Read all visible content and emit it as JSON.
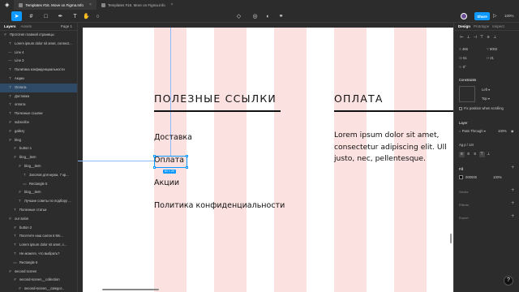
{
  "browser_tabs": [
    {
      "label": "Templates #16. Move on Figma.Info",
      "active": true
    },
    {
      "label": "Templates #16. More on Figma.Info",
      "active": false
    }
  ],
  "toolbar": {
    "present_icon": "play-icon",
    "share_label": "Share",
    "zoom_label": "100%"
  },
  "left_panel": {
    "tab_layers": "Layers",
    "tab_assets": "Assets",
    "page_label": "Page 1",
    "layers": [
      {
        "label": "Прототип главной страницы",
        "icon": "#",
        "indent": 0
      },
      {
        "label": "Lorem ipsum dolor sit amet, consect...",
        "icon": "T",
        "indent": 1
      },
      {
        "label": "Line 4",
        "icon": "—",
        "indent": 1
      },
      {
        "label": "Line 3",
        "icon": "—",
        "indent": 1
      },
      {
        "label": "Политика конфиденциальности",
        "icon": "T",
        "indent": 1
      },
      {
        "label": "Акции",
        "icon": "T",
        "indent": 1
      },
      {
        "label": "Оплата",
        "icon": "T",
        "indent": 1,
        "selected": true
      },
      {
        "label": "Доставка",
        "icon": "T",
        "indent": 1
      },
      {
        "label": "оплата",
        "icon": "T",
        "indent": 1
      },
      {
        "label": "Полезные ссылки",
        "icon": "T",
        "indent": 1
      },
      {
        "label": "subscribe",
        "icon": "#",
        "indent": 1
      },
      {
        "label": "gallery",
        "icon": "#",
        "indent": 1
      },
      {
        "label": "blog",
        "icon": "#",
        "indent": 1
      },
      {
        "label": "button 1",
        "icon": "#",
        "indent": 2
      },
      {
        "label": "blog__item",
        "icon": "#",
        "indent": 2
      },
      {
        "label": "blog__item",
        "icon": "#",
        "indent": 3
      },
      {
        "label": "Заголов для мужа. 7 кр...",
        "icon": "T",
        "indent": 4
      },
      {
        "label": "Rectangle 5",
        "icon": "▭",
        "indent": 4
      },
      {
        "label": "blog__item",
        "icon": "#",
        "indent": 3
      },
      {
        "label": "Лучшие советы по подбору ...",
        "icon": "T",
        "indent": 3
      },
      {
        "label": "Полезные статьи",
        "icon": "T",
        "indent": 2
      },
      {
        "label": "our salon",
        "icon": "#",
        "indent": 1
      },
      {
        "label": "button 2",
        "icon": "#",
        "indent": 2
      },
      {
        "label": "Посетите наш салон в Мо...",
        "icon": "T",
        "indent": 2
      },
      {
        "label": "Lorem ipsum dolor sit amet, c...",
        "icon": "T",
        "indent": 2
      },
      {
        "label": "Не можете, что выбрать?",
        "icon": "T",
        "indent": 2
      },
      {
        "label": "Rectangle 6",
        "icon": "▭",
        "indent": 2
      },
      {
        "label": "second screen",
        "icon": "#",
        "indent": 1
      },
      {
        "label": "second-screen__collection",
        "icon": "#",
        "indent": 2
      },
      {
        "label": "second-screen__categor...",
        "icon": "#",
        "indent": 3
      }
    ]
  },
  "canvas": {
    "heading_links": "ПОЛЕЗНЫЕ ССЫЛКИ",
    "heading_payment": "ОПЛАТА",
    "links": [
      "Доставка",
      "Оплата",
      "Акции",
      "Политика конфиденциальности"
    ],
    "selection_size": "61 × 20",
    "lorem_lines": [
      "Lorem ipsum dolor sit amet,",
      "consectetur adipiscing elit. Ull",
      "justo, nec, pellentesque."
    ]
  },
  "right_panel": {
    "tab_design": "Design",
    "tab_prototype": "Prototype",
    "tab_inspect": "Inspect",
    "x": "466",
    "y": "5002",
    "w": "61",
    "h": "21",
    "rotation": "0°",
    "constraints_title": "Constraints",
    "constraint_h": "Left",
    "constraint_v": "Top",
    "fix_scroll": "Fix position when scrolling",
    "layer_title": "Layer",
    "blend": "Pass Through",
    "opacity": "100%",
    "text_style": "Ag  p / 14r",
    "fill_title": "Fill",
    "fill_hex": "000000",
    "fill_opacity": "100%",
    "stroke_title": "Stroke",
    "effects_title": "Effects",
    "export_title": "Export"
  }
}
